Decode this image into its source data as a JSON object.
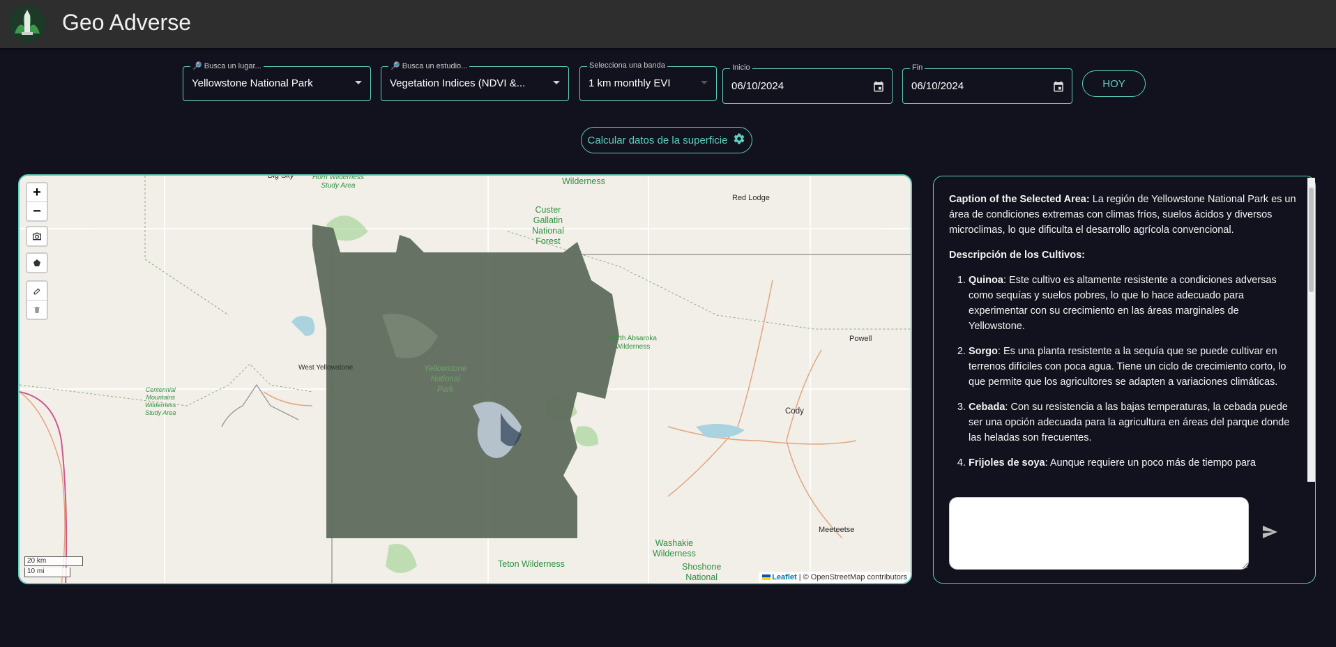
{
  "app": {
    "title": "Geo Adverse"
  },
  "filters": {
    "place": {
      "label": "🔎 Busca un lugar...",
      "value": "Yellowstone National Park"
    },
    "study": {
      "label": "🔎 Busca un estudio...",
      "value": "Vegetation Indices (NDVI &..."
    },
    "band": {
      "label": "Selecciona una banda",
      "value": "1 km monthly EVI"
    },
    "start": {
      "label": "Inicio",
      "value": "06/10/2024"
    },
    "end": {
      "label": "Fin",
      "value": "06/10/2024"
    },
    "today_label": "HOY"
  },
  "calculate_label": "Calcular datos de la superficie",
  "map": {
    "zoom_in": "+",
    "zoom_out": "−",
    "labels": {
      "big_sky": "Big Sky",
      "red_lodge": "Red Lodge",
      "powell": "Powell",
      "cody": "Cody",
      "meeteetse": "Meeteetse",
      "west_yellowstone": "West Yellowstone",
      "horn_wilderness": "Horn Wilderness\nStudy Area",
      "wilderness_top": "Wilderness",
      "custer": "Custer\nGallatin\nNational\nForest",
      "north_absaroka": "North Absaroka\nWilderness",
      "yellowstone_park": "Yellowstone\nNational\nPark",
      "centennial": "Centennial\nMountains\nWilderness\nStudy Area",
      "teton": "Teton Wilderness",
      "washakie": "Washakie\nWilderness",
      "shoshone": "Shoshone\nNational"
    },
    "scale": {
      "metric": "20 km",
      "imperial": "10 mi"
    },
    "attribution": {
      "leaflet": "Leaflet",
      "rest": " | © OpenStreetMap contributors"
    }
  },
  "caption": {
    "intro_title": "Caption of the Selected Area:",
    "intro_text": " La región de Yellowstone National Park es un área de condiciones extremas con climas fríos, suelos ácidos y diversos microclimas, lo que dificulta el desarrollo agrícola convencional.",
    "crops_title": "Descripción de los Cultivos:",
    "crops": [
      {
        "name": "Quinoa",
        "text": ": Este cultivo es altamente resistente a condiciones adversas como sequías y suelos pobres, lo que lo hace adecuado para experimentar con su crecimiento en las áreas marginales de Yellowstone."
      },
      {
        "name": "Sorgo",
        "text": ": Es una planta resistente a la sequía que se puede cultivar en terrenos difíciles con poca agua. Tiene un ciclo de crecimiento corto, lo que permite que los agricultores se adapten a variaciones climáticas."
      },
      {
        "name": "Cebada",
        "text": ": Con su resistencia a las bajas temperaturas, la cebada puede ser una opción adecuada para la agricultura en áreas del parque donde las heladas son frecuentes."
      },
      {
        "name": "Frijoles de soya",
        "text": ": Aunque requiere un poco más de tiempo para"
      }
    ]
  },
  "chat": {
    "placeholder": ""
  },
  "colors": {
    "accent": "#5fcfbf",
    "background": "#11121e",
    "appbar": "#2e2e2e"
  }
}
